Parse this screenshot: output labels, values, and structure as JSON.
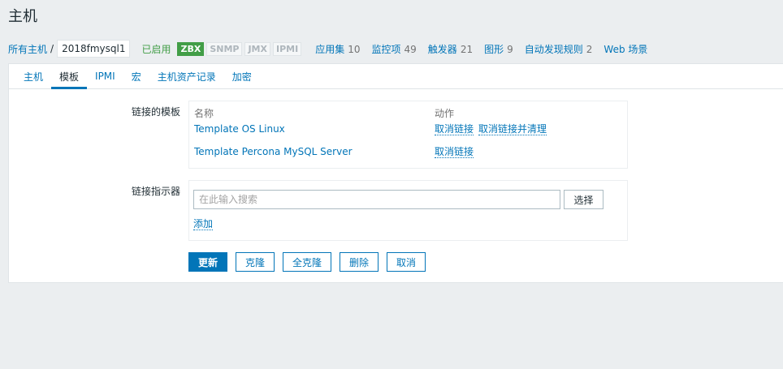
{
  "page": {
    "title": "主机"
  },
  "breadcrumb": {
    "all_hosts": "所有主机",
    "separator": "/",
    "current_host": "2018fmysql1"
  },
  "status": {
    "enabled": "已启用"
  },
  "availability": {
    "zbx": "ZBX",
    "snmp": "SNMP",
    "jmx": "JMX",
    "ipmi": "IPMI"
  },
  "stats": [
    {
      "label": "应用集",
      "count": "10"
    },
    {
      "label": "监控项",
      "count": "49"
    },
    {
      "label": "触发器",
      "count": "21"
    },
    {
      "label": "图形",
      "count": "9"
    },
    {
      "label": "自动发现规则",
      "count": "2"
    },
    {
      "label": "Web 场景",
      "count": ""
    }
  ],
  "tabs": [
    "主机",
    "模板",
    "IPMI",
    "宏",
    "主机资产记录",
    "加密"
  ],
  "active_tab": "模板",
  "linked_templates": {
    "label": "链接的模板",
    "col_name": "名称",
    "col_action": "动作",
    "rows": [
      {
        "name": "Template OS Linux",
        "unlink": "取消链接",
        "unlink_clear": "取消链接并清理"
      },
      {
        "name": "Template Percona MySQL Server",
        "unlink": "取消链接"
      }
    ]
  },
  "link_new": {
    "label": "链接指示器",
    "placeholder": "在此输入搜索",
    "select": "选择",
    "add": "添加"
  },
  "buttons": {
    "update": "更新",
    "clone": "克隆",
    "full_clone": "全克隆",
    "delete": "删除",
    "cancel": "取消"
  },
  "colors": {
    "link": "#0275b8",
    "enabled": "#429e47",
    "background": "#ebeef0"
  }
}
